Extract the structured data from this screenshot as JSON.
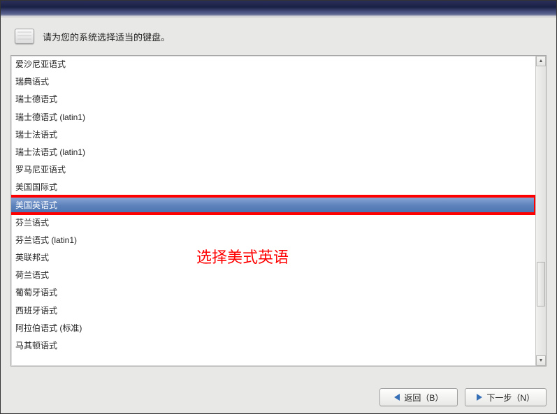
{
  "instruction": "请为您的系统选择适当的键盘。",
  "selected_index": 8,
  "keyboard_list": {
    "items": [
      "爱沙尼亚语式",
      "瑞典语式",
      "瑞士德语式",
      "瑞士德语式 (latin1)",
      "瑞士法语式",
      "瑞士法语式 (latin1)",
      "罗马尼亚语式",
      "美国国际式",
      "美国英语式",
      "芬兰语式",
      "芬兰语式 (latin1)",
      "英联邦式",
      "荷兰语式",
      "葡萄牙语式",
      "西班牙语式",
      "阿拉伯语式 (标准)",
      "马其顿语式"
    ]
  },
  "annotation_text": "选择美式英语",
  "buttons": {
    "back": "返回（B）",
    "next": "下一步（N）"
  }
}
